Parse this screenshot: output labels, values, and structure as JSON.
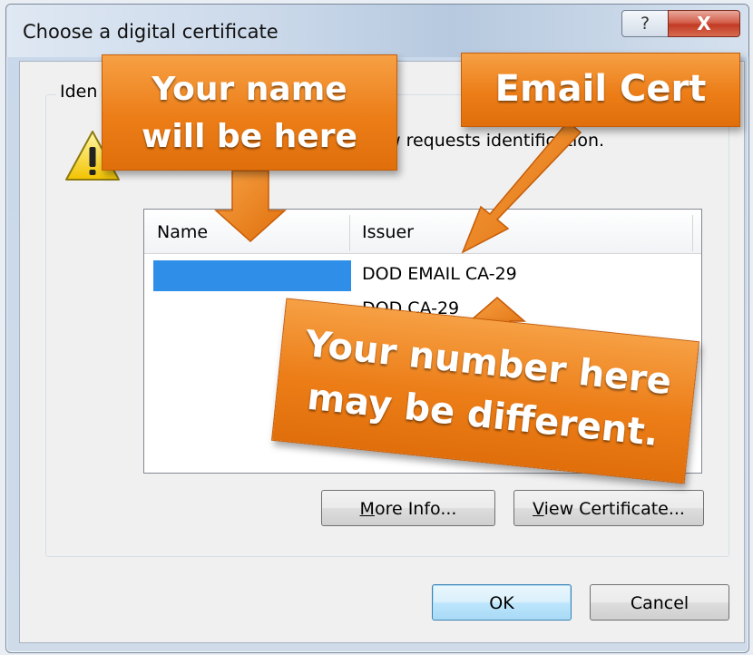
{
  "window": {
    "title": "Choose a digital certificate",
    "help_glyph": "?",
    "close_glyph": "X"
  },
  "group": {
    "label": "Iden",
    "description": "w requests identification."
  },
  "cert_list": {
    "columns": [
      "Name",
      "Issuer"
    ],
    "rows": [
      {
        "name": "",
        "issuer": "DOD EMAIL CA-29"
      },
      {
        "name": "",
        "issuer": "DOD CA-29"
      }
    ],
    "redaction_color": "#2f8fe8"
  },
  "buttons": {
    "more_info": {
      "mnemonic": "M",
      "rest": "ore Info..."
    },
    "view_certificate": {
      "mnemonic": "V",
      "rest": "iew Certificate..."
    },
    "ok": "OK",
    "cancel": "Cancel"
  },
  "annotations": {
    "name_callout": [
      "Your name",
      "will be here"
    ],
    "email_callout": "Email Cert",
    "number_callout": [
      "Your number here",
      "may be different."
    ],
    "accent_color": "#ec7d17"
  }
}
